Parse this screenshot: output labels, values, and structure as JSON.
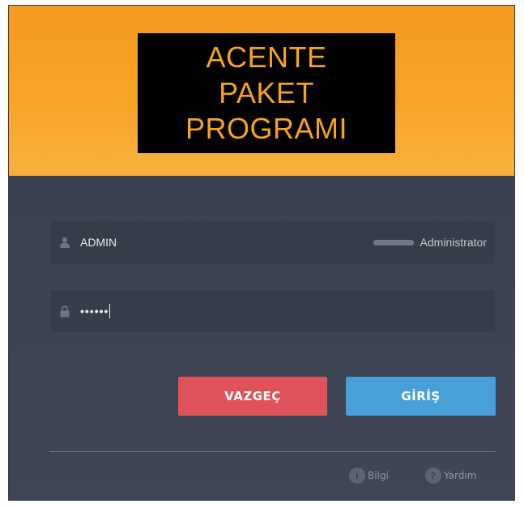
{
  "logo": {
    "lines": [
      "ACENTE",
      "PAKET",
      "PROGRAMI"
    ],
    "text_color": "#f6a21d",
    "background": "#000000"
  },
  "login": {
    "username": {
      "value": "ADMIN",
      "icon": "user-icon"
    },
    "role": {
      "label": "Administrator"
    },
    "password": {
      "value": "••••••",
      "icon": "lock-icon"
    }
  },
  "buttons": {
    "cancel_label": "VAZGEÇ",
    "login_label": "GİRİŞ",
    "cancel_color": "#e0525a",
    "login_color": "#48a0d8"
  },
  "footer": {
    "info_label": "Bilgi",
    "help_label": "Yardım",
    "info_icon": "info-icon",
    "help_icon": "help-icon"
  },
  "colors": {
    "banner": "#f8a328",
    "panel": "#3d4452"
  }
}
